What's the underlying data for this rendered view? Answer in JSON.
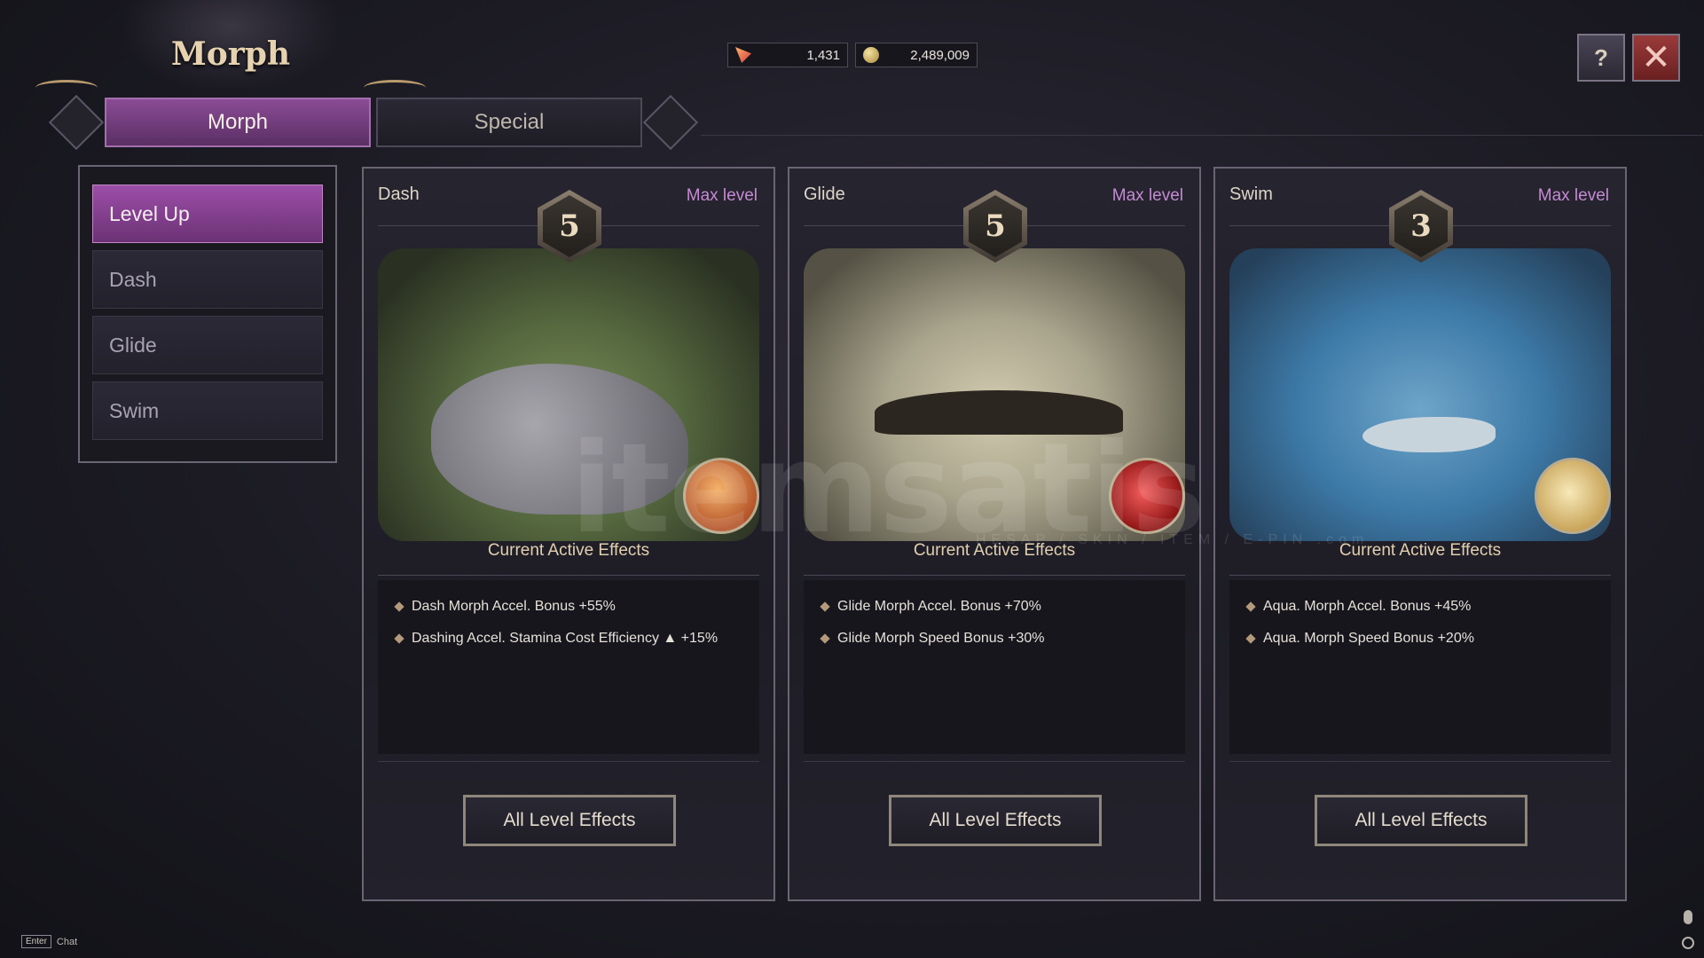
{
  "header": {
    "title": "Morph",
    "currencies": [
      {
        "icon": "gem-icon",
        "value": "1,431"
      },
      {
        "icon": "coin-icon",
        "value": "2,489,009"
      }
    ],
    "help_icon": "question-book-icon",
    "close_icon": "close-icon"
  },
  "tabs": [
    {
      "label": "Morph",
      "active": true
    },
    {
      "label": "Special",
      "active": false
    }
  ],
  "side_menu": [
    {
      "label": "Level Up",
      "active": true
    },
    {
      "label": "Dash",
      "active": false
    },
    {
      "label": "Glide",
      "active": false
    },
    {
      "label": "Swim",
      "active": false
    }
  ],
  "cards": [
    {
      "name": "Dash",
      "level": "5",
      "status": "Max level",
      "effects_title": "Current Active Effects",
      "effects": [
        "Dash Morph Accel. Bonus +55%",
        "Dashing Accel. Stamina Cost Efficiency ▲ +15%"
      ],
      "button": "All Level Effects"
    },
    {
      "name": "Glide",
      "level": "5",
      "status": "Max level",
      "effects_title": "Current Active Effects",
      "effects": [
        "Glide Morph Accel. Bonus +70%",
        "Glide Morph Speed Bonus  +30%"
      ],
      "button": "All Level Effects"
    },
    {
      "name": "Swim",
      "level": "3",
      "status": "Max level",
      "effects_title": "Current Active Effects",
      "effects": [
        "Aqua. Morph Accel. Bonus +45%",
        "Aqua. Morph Speed Bonus +20%"
      ],
      "button": "All Level Effects"
    }
  ],
  "footer": {
    "key": "Enter",
    "label": "Chat"
  },
  "watermark": {
    "text": "itemsatis",
    "sub": "HESAP / SKIN / ITEM / E-PIN .com"
  },
  "colors": {
    "accent_purple": "#8a4c95",
    "max_level_text": "#c58ad4",
    "close_red": "#9a3a3a"
  }
}
